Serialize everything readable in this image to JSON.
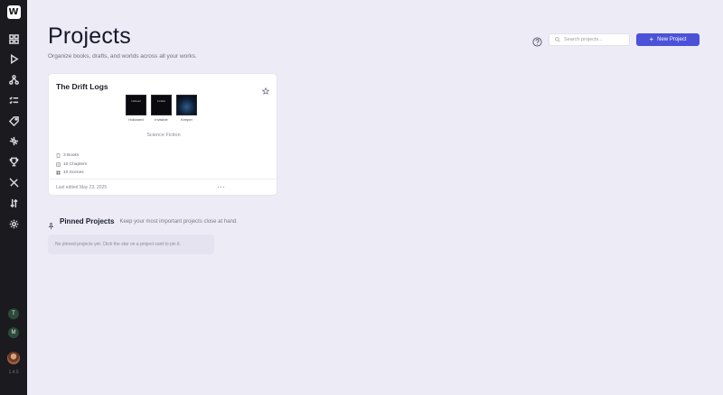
{
  "sidebar": {
    "logo_letter": "W",
    "nav_icons": [
      "grid-icon",
      "play-icon",
      "nodes-icon",
      "checklist-icon",
      "tag-icon",
      "network-icon",
      "trophy-icon",
      "tools-icon",
      "sort-icon",
      "gear-icon"
    ],
    "workspaces": [
      "T",
      "M"
    ],
    "version": "1.4.0"
  },
  "header": {
    "title": "Projects",
    "subtitle": "Organize books, drafts, and worlds across all your works.",
    "search_placeholder": "Search projects...",
    "new_button_label": "New Project"
  },
  "project_card": {
    "title": "The Drift Logs",
    "books": [
      {
        "cover_text": "hollowed",
        "label": "Hollowed"
      },
      {
        "cover_text": "invisible",
        "label": "Invisible"
      },
      {
        "cover_text": "",
        "label": "Keeper"
      }
    ],
    "genre": "Science Fiction",
    "stats": {
      "books": "3 Books",
      "chapters": "10 Chapters",
      "scenes": "10 Scenes"
    },
    "last_edited": "Last edited May 23, 2025",
    "more_label": "···"
  },
  "pinned": {
    "title": "Pinned Projects",
    "subtitle": "Keep your most important projects close at hand.",
    "empty_message": "No pinned projects yet. Click the star on a project card to pin it."
  },
  "colors": {
    "sidebar_bg": "#1b1b1f",
    "page_bg": "#ecebf6",
    "accent": "#4b52d8"
  }
}
